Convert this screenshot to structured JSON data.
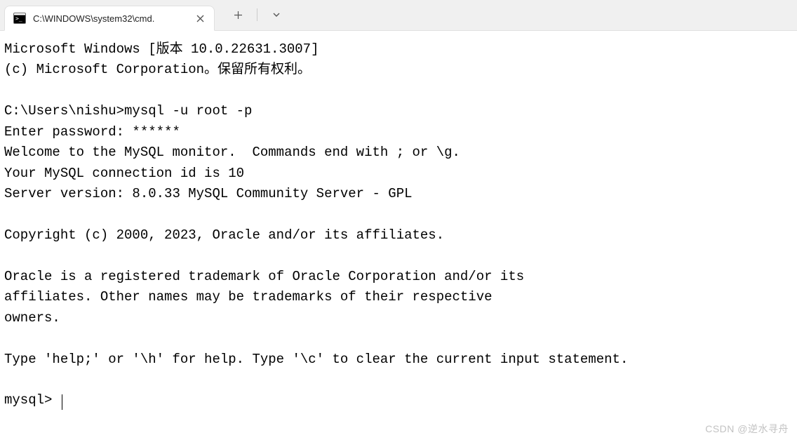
{
  "tab": {
    "title": "C:\\WINDOWS\\system32\\cmd."
  },
  "terminal": {
    "lines": [
      "Microsoft Windows [版本 10.0.22631.3007]",
      "(c) Microsoft Corporation。保留所有权利。",
      "",
      "C:\\Users\\nishu>mysql -u root -p",
      "Enter password: ******",
      "Welcome to the MySQL monitor.  Commands end with ; or \\g.",
      "Your MySQL connection id is 10",
      "Server version: 8.0.33 MySQL Community Server - GPL",
      "",
      "Copyright (c) 2000, 2023, Oracle and/or its affiliates.",
      "",
      "Oracle is a registered trademark of Oracle Corporation and/or its",
      "affiliates. Other names may be trademarks of their respective",
      "owners.",
      "",
      "Type 'help;' or '\\h' for help. Type '\\c' to clear the current input statement.",
      ""
    ],
    "prompt": "mysql> "
  },
  "watermark": "CSDN @逆水寻舟"
}
